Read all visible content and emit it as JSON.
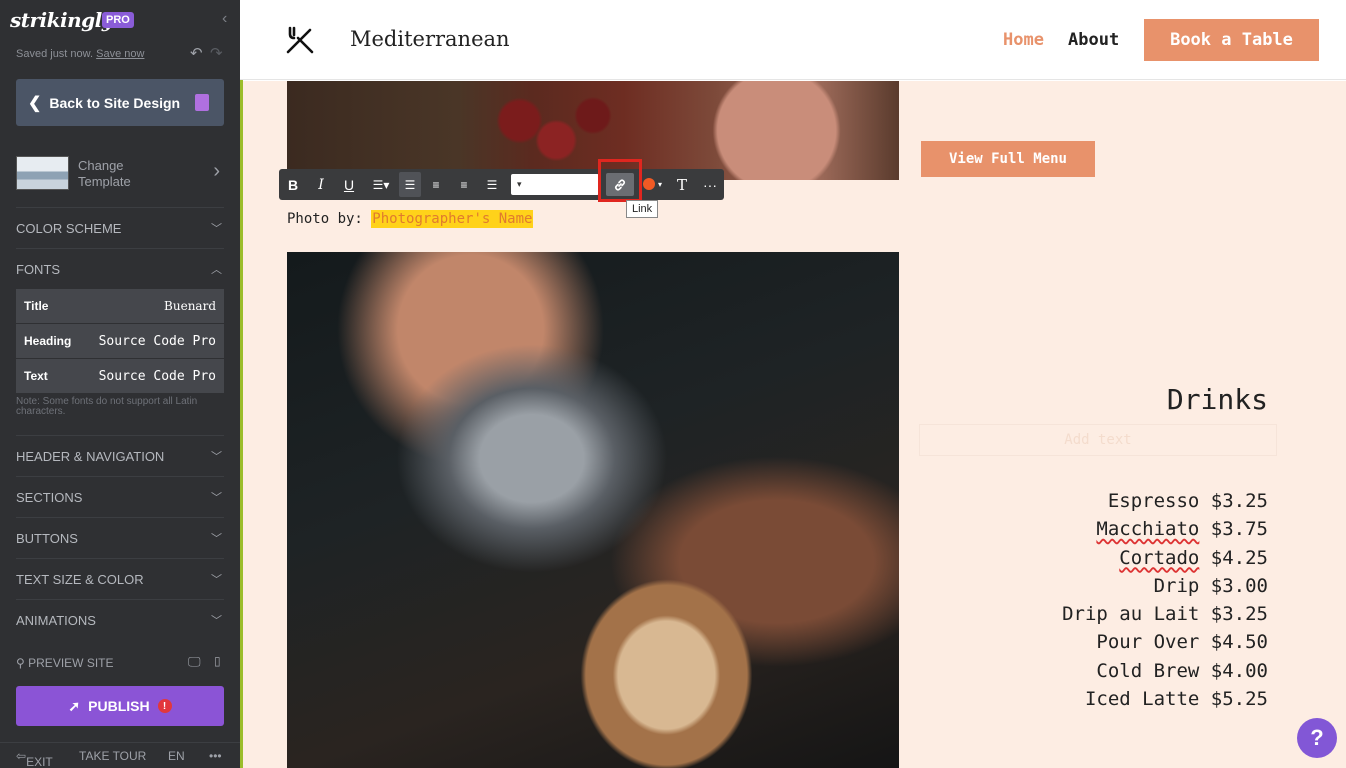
{
  "sidebar": {
    "logo": "strikingly",
    "pro_badge": "PRO",
    "saved_text": "Saved just now.",
    "save_now": "Save now",
    "back_button": "Back to Site Design",
    "change_template": "Change Template",
    "sections": {
      "color_scheme": "COLOR SCHEME",
      "fonts": "FONTS",
      "header_navigation": "HEADER & NAVIGATION",
      "sections": "SECTIONS",
      "buttons": "BUTTONS",
      "text_size_color": "TEXT SIZE & COLOR",
      "animations": "ANIMATIONS"
    },
    "fonts": [
      {
        "label": "Title",
        "value": "Buenard"
      },
      {
        "label": "Heading",
        "value": "Source Code Pro"
      },
      {
        "label": "Text",
        "value": "Source Code Pro"
      }
    ],
    "fonts_note": "Note: Some fonts do not support all Latin characters.",
    "preview_site": "PREVIEW SITE",
    "publish": "PUBLISH",
    "publish_alert": "!",
    "bottom": {
      "exit": "EXIT",
      "take_tour": "TAKE TOUR",
      "language": "EN",
      "more": "•••"
    }
  },
  "site_header": {
    "title": "Mediterranean",
    "nav": {
      "home": "Home",
      "about": "About"
    },
    "book_button": "Book a Table"
  },
  "main": {
    "view_menu_button": "View Full Menu",
    "toolbar": {
      "bold": "B",
      "italic": "I",
      "underline": "U",
      "font_size_value": "",
      "link_tooltip": "Link",
      "text_style": "T",
      "more": "···"
    },
    "photo_credit_prefix": "Photo by:",
    "photo_credit_name": "Photographer's Name",
    "drinks": {
      "title": "Drinks",
      "subtitle": "Add text",
      "items": [
        {
          "name": "Espresso",
          "price": "$3.25"
        },
        {
          "name": "Macchiato",
          "price": "$3.75"
        },
        {
          "name": "Cortado",
          "price": "$4.25"
        },
        {
          "name": "Drip",
          "price": "$3.00"
        },
        {
          "name": "Drip au Lait",
          "price": "$3.25"
        },
        {
          "name": "Pour Over",
          "price": "$4.50"
        },
        {
          "name": "Cold Brew",
          "price": "$4.00"
        },
        {
          "name": "Iced Latte",
          "price": "$5.25"
        }
      ]
    }
  },
  "help_button": "?",
  "colors": {
    "sidebar_bg": "#2f3033",
    "accent_orange": "#e8926b",
    "publish_purple": "#8b54d6",
    "page_bg": "#fdede3",
    "highlight_yellow": "#ffd21a",
    "link_box_red": "#e0261f"
  },
  "icons": [
    "fork-knife-icon",
    "chevron-left-icon",
    "chevron-right-icon",
    "chevron-down-icon",
    "chevron-up-icon",
    "undo-icon",
    "redo-icon",
    "search-icon",
    "desktop-icon",
    "mobile-icon",
    "rocket-icon",
    "link-icon",
    "help-icon"
  ]
}
